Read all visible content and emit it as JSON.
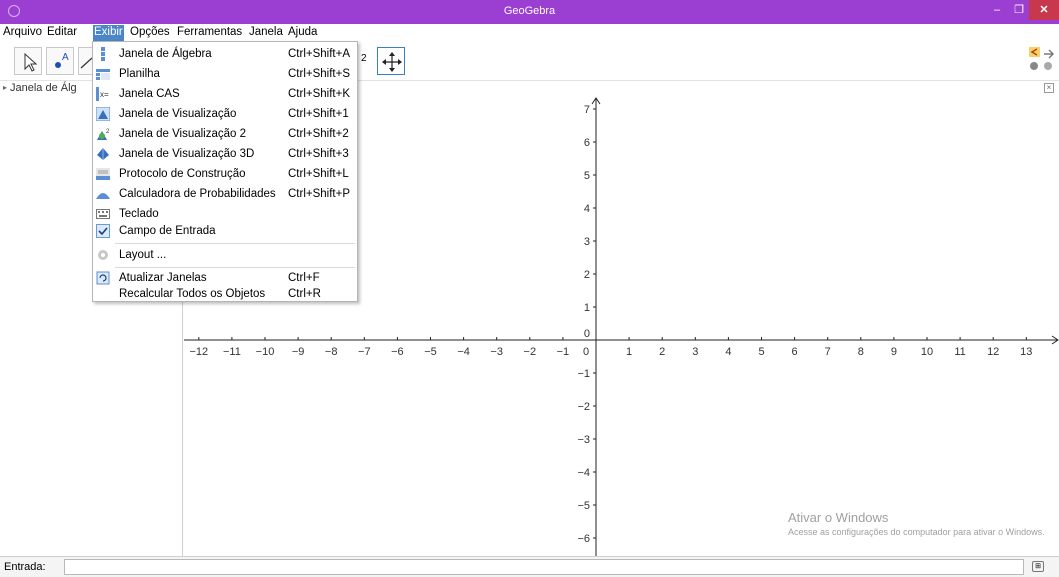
{
  "window": {
    "title": "GeoGebra",
    "controls": [
      "–",
      "❐",
      "✕"
    ]
  },
  "menubar": {
    "items": [
      "Arquivo",
      "Editar",
      "Exibir",
      "Opções",
      "Ferramentas",
      "Janela",
      "Ajuda"
    ],
    "open": "Exibir"
  },
  "toolbar": {
    "partial_label": "2"
  },
  "algebra_header": {
    "label": "Janela de Álg"
  },
  "view_menu": {
    "items": [
      {
        "label": "Janela de Álgebra",
        "shortcut": "Ctrl+Shift+A",
        "icon": "algebra-view-icon"
      },
      {
        "label": "Planilha",
        "shortcut": "Ctrl+Shift+S",
        "icon": "spreadsheet-icon"
      },
      {
        "label": "Janela CAS",
        "shortcut": "Ctrl+Shift+K",
        "icon": "cas-icon"
      },
      {
        "label": "Janela de Visualização",
        "shortcut": "Ctrl+Shift+1",
        "icon": "graphics-view-icon"
      },
      {
        "label": "Janela de Visualização 2",
        "shortcut": "Ctrl+Shift+2",
        "icon": "graphics-view-2-icon"
      },
      {
        "label": "Janela de Visualização 3D",
        "shortcut": "Ctrl+Shift+3",
        "icon": "graphics-3d-icon"
      },
      {
        "label": "Protocolo de Construção",
        "shortcut": "Ctrl+Shift+L",
        "icon": "construction-protocol-icon"
      },
      {
        "label": "Calculadora de Probabilidades",
        "shortcut": "Ctrl+Shift+P",
        "icon": "probability-calculator-icon"
      },
      {
        "label": "Teclado",
        "shortcut": "",
        "icon": "keyboard-icon"
      },
      {
        "label": "Campo de Entrada",
        "shortcut": "",
        "icon": "checkbox-checked-icon",
        "checked": true
      },
      {
        "label": "Layout ...",
        "shortcut": "",
        "icon": "gear-icon"
      },
      {
        "label": "Atualizar Janelas",
        "shortcut": "Ctrl+F",
        "icon": "refresh-icon"
      },
      {
        "label": "Recalcular Todos os Objetos",
        "shortcut": "Ctrl+R",
        "icon": ""
      }
    ]
  },
  "graphics": {
    "x_ticks": [
      "−12",
      "−11",
      "−10",
      "−9",
      "−8",
      "−7",
      "−6",
      "−5",
      "−4",
      "−3",
      "−2",
      "−1",
      "0",
      "1",
      "2",
      "3",
      "4",
      "5",
      "6",
      "7",
      "8",
      "9",
      "10",
      "11",
      "12",
      "13"
    ],
    "y_ticks": [
      "7",
      "6",
      "5",
      "4",
      "3",
      "2",
      "1",
      "0",
      "−1",
      "−2",
      "−3",
      "−4",
      "−5",
      "−6"
    ]
  },
  "inputbar": {
    "label": "Entrada:",
    "value": ""
  },
  "watermark": {
    "title": "Ativar o Windows",
    "text": "Acesse as configurações do computador para ativar o Windows."
  },
  "colors": {
    "titlebar": "#9a3fd1",
    "menu_highlight": "#4a86c8",
    "close": "#c7374e"
  }
}
